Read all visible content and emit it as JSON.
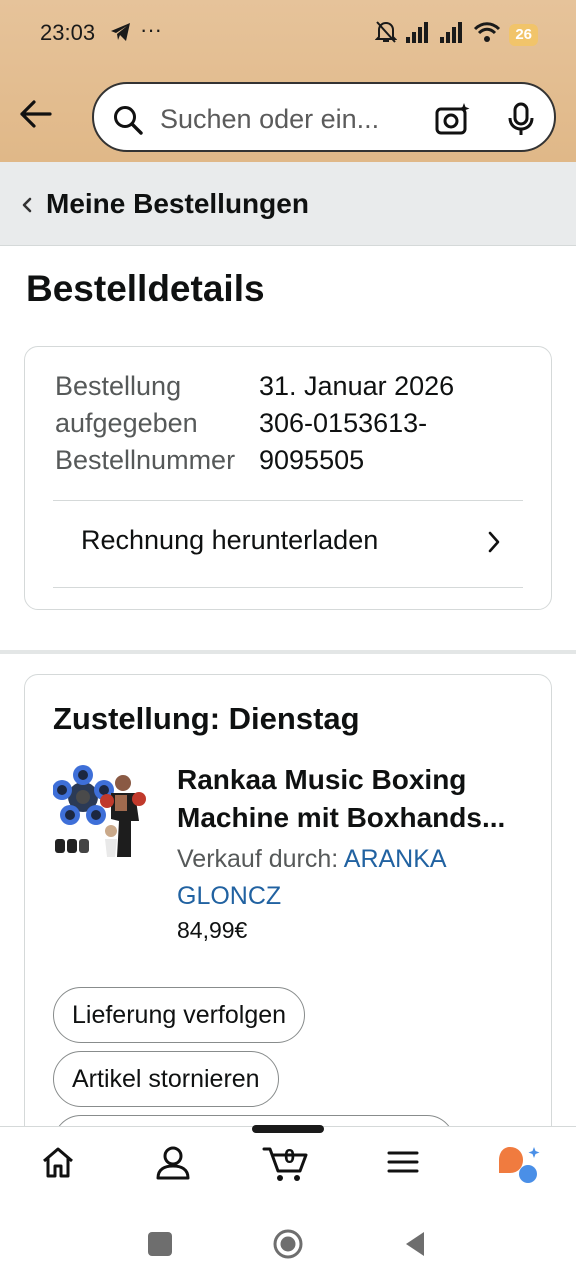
{
  "status_bar": {
    "time": "23:03",
    "more": "···",
    "battery": "26"
  },
  "search": {
    "placeholder": "Suchen oder ein..."
  },
  "breadcrumb": {
    "label": "Meine Bestellungen"
  },
  "page": {
    "title": "Bestelldetails"
  },
  "order": {
    "placed_label": "Bestellung aufgegeben",
    "placed_label_1": "Bestellung",
    "placed_label_2": "aufgegeben",
    "placed_value": "31. Januar 2026",
    "number_label": "Bestellnummer",
    "number_value_1": "306-0153613-",
    "number_value_2": "9095505",
    "invoice_label": "Rechnung herunterladen"
  },
  "shipment": {
    "delivery": "Zustellung: Dienstag",
    "product_title": "Rankaa Music Boxing Machine mit Boxhands...",
    "sold_by_label": "Verkauf durch: ",
    "seller": "ARANKA GLONCZ",
    "price": "84,99€",
    "actions": [
      "Lieferung verfolgen",
      "Artikel stornieren",
      ""
    ]
  },
  "tabbar": {
    "cart_count": "0",
    "icons": [
      "home-icon",
      "account-icon",
      "cart-icon",
      "menu-icon",
      "assistant-icon"
    ]
  },
  "colors": {
    "header": "#e4bd8f",
    "link": "#2162a1",
    "subnav": "#e9ebec"
  }
}
